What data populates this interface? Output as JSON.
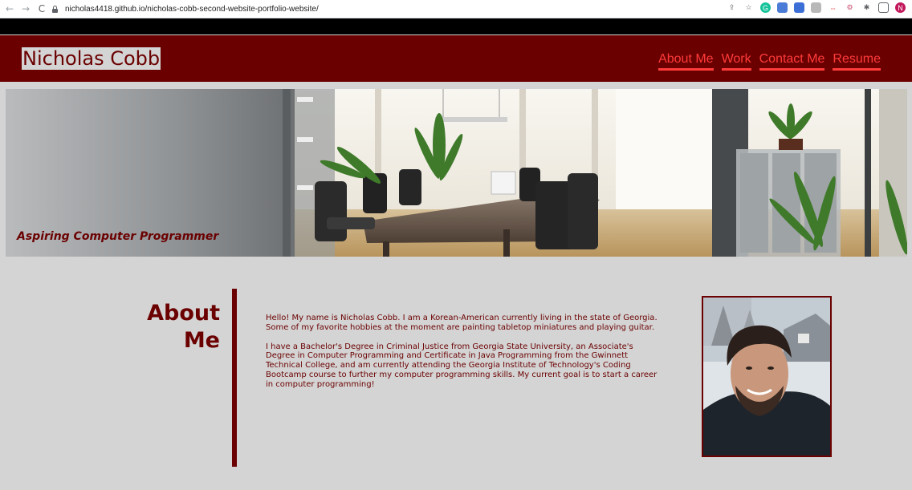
{
  "browser": {
    "url": "nicholas4418.github.io/nicholas-cobb-second-website-portfolio-website/",
    "profile_initial": "N"
  },
  "site": {
    "title": "Nicholas Cobb",
    "nav": [
      "About Me",
      "Work",
      "Contact Me",
      "Resume"
    ],
    "hero_tagline": "Aspiring Computer Programmer"
  },
  "about": {
    "heading_line1": "About",
    "heading_line2": "Me",
    "paragraph1": "Hello! My name is Nicholas Cobb. I am a Korean-American currently living in the state of Georgia. Some of my favorite hobbies at the moment are painting tabletop miniatures and playing guitar.",
    "paragraph2": "I have a Bachelor's Degree in Criminal Justice from Georgia State University, an Associate's Degree in Computer Programming and Certificate in Java Programming from the Gwinnett Technical College, and am currently attending the Georgia Institute of Technology's Coding Bootcamp course to further my computer programming skills. My current goal is to start a career in computer programming!"
  },
  "colors": {
    "brand": "#6b0000",
    "nav_link": "#ff3b3b",
    "page_bg": "#d4d4d4"
  }
}
